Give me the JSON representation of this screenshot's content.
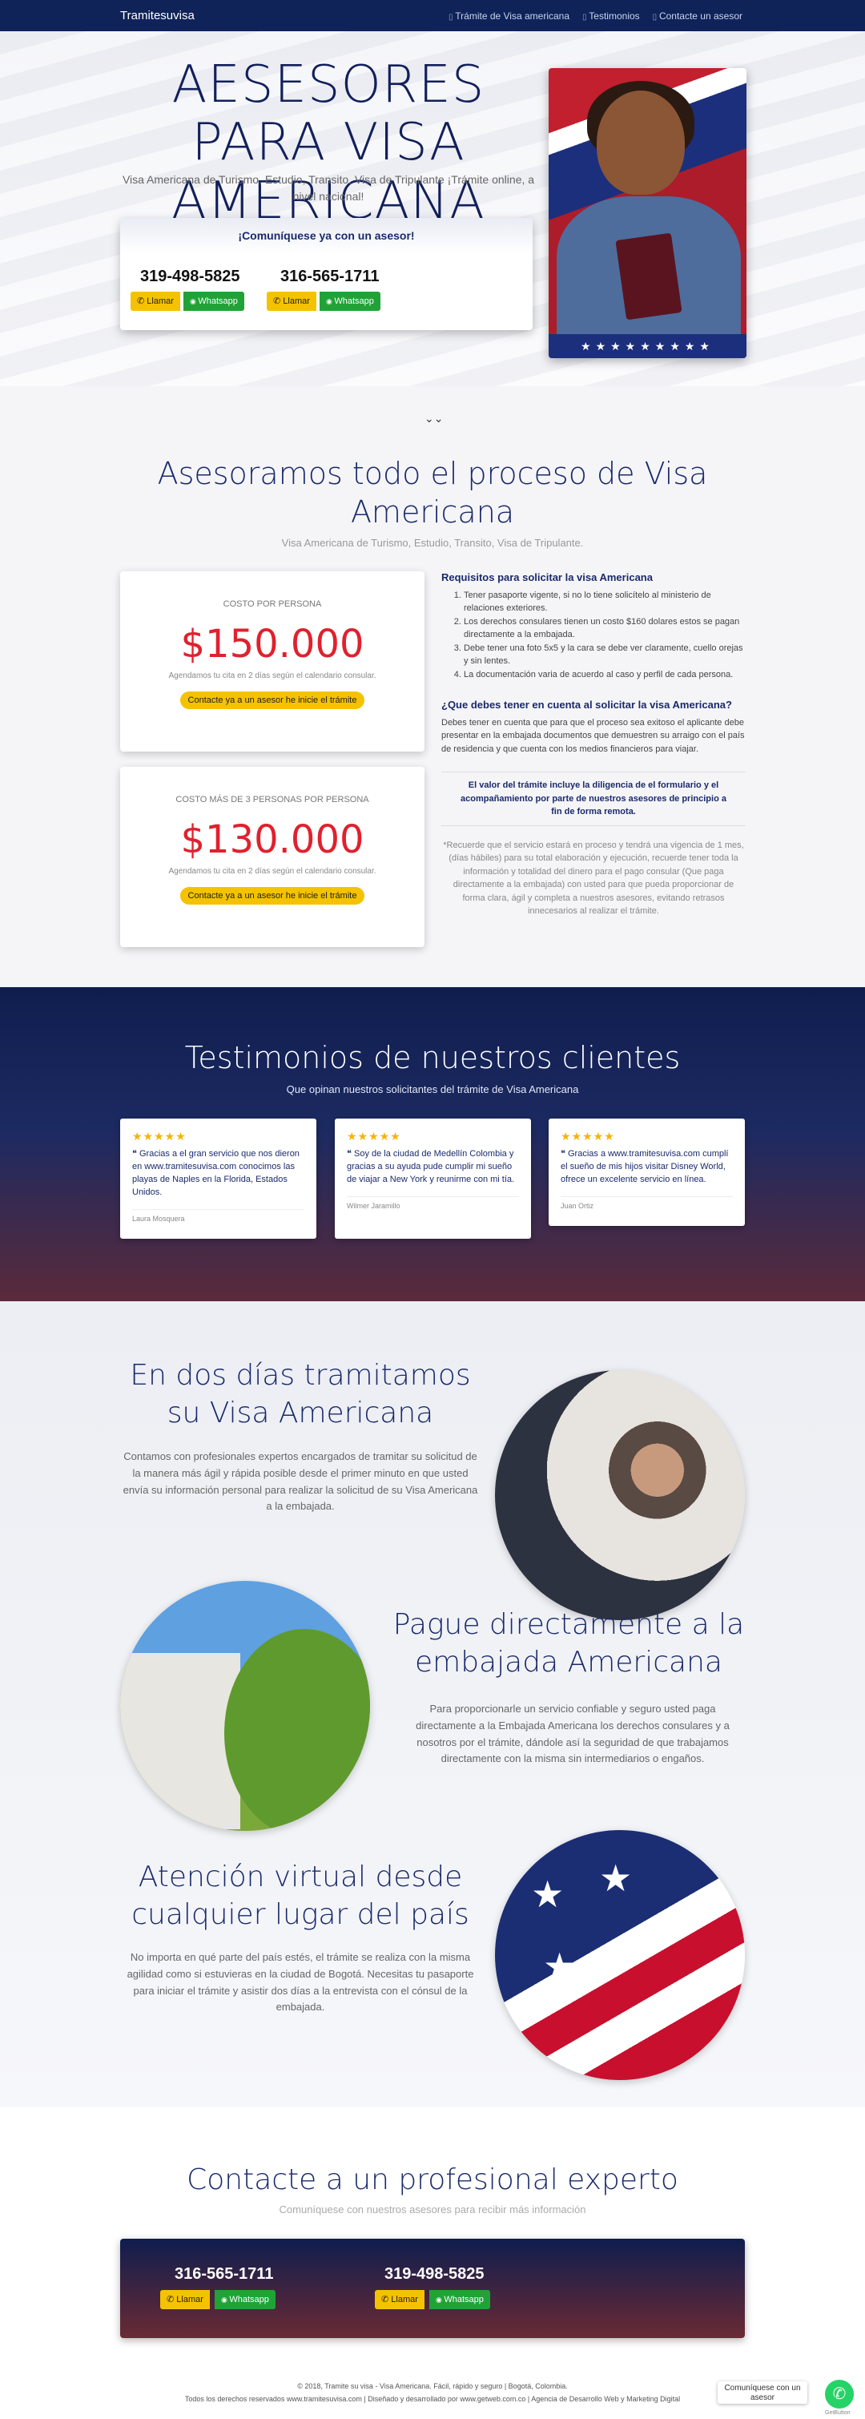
{
  "nav": {
    "brand": "Tramitesuvisa",
    "links": [
      "Trámite de Visa americana",
      "Testimonios",
      "Contacte un asesor"
    ]
  },
  "hero": {
    "title": "AESESORES PARA VISA AMERICANA",
    "subtitle": "Visa Americana de Turismo, Estudio, Transito, Visa de Tripulante ¡Trámite online, a nivel nacional!",
    "call_heading": "¡Comuníquese ya con un asesor!",
    "phones": [
      "319-498-5825",
      "316-565-1711"
    ],
    "call_label": "Llamar",
    "wa_label": "Whatsapp"
  },
  "process": {
    "title": "Asesoramos todo el proceso de Visa Americana",
    "subtitle": "Visa Americana de Turismo, Estudio, Transito, Visa de Tripulante.",
    "prices": [
      {
        "label": "COSTO POR PERSONA",
        "amount": "$150.000",
        "note": "Agendamos tu cita en 2 días según el calendario consular.",
        "cta": "Contacte ya a un asesor he inicie el trámite"
      },
      {
        "label": "COSTO MÁS DE 3 PERSONAS POR PERSONA",
        "amount": "$130.000",
        "note": "Agendamos tu cita en 2 días según el calendario consular.",
        "cta": "Contacte ya a un asesor he inicie el trámite"
      }
    ],
    "req_title": "Requisitos para solicitar la visa Americana",
    "req_items": [
      "Tener pasaporte vigente, si no lo tiene solicítelo al ministerio de relaciones exteriores.",
      "Los derechos consulares tienen un costo $160 dolares estos se pagan directamente a la embajada.",
      "Debe tener una foto 5x5 y la cara se debe ver claramente, cuello orejas y sin lentes.",
      "La documentación varia de acuerdo al caso y perfil de cada persona."
    ],
    "q_title": "¿Que debes tener en cuenta al solicitar la visa Americana?",
    "q_text": "Debes tener en cuenta que para que el proceso sea exitoso el aplicante debe presentar en la embajada documentos que demuestren su arraigo con el país de residencia y que cuenta con los medios financieros para viajar.",
    "highlight": "El valor del trámite incluye la diligencia de el formulario y el acompañamiento por parte de nuestros asesores de principio a fin de forma remota.",
    "fine": "*Recuerde que el servicio estará en proceso y tendrá una vigencia de 1 mes, (días hábiles) para su total elaboración y ejecución, recuerde tener toda la información y totalidad del dinero para el pago consular (Que paga directamente a la embajada) con usted para que pueda proporcionar de forma clara, ágil y completa a nuestros asesores, evitando retrasos innecesarios al realizar el trámite."
  },
  "testimonials": {
    "title": "Testimonios de nuestros clientes",
    "subtitle": "Que opinan nuestros solicitantes del trámite de Visa Americana",
    "stars": "★★★★★",
    "items": [
      {
        "text": "Gracias a el gran servicio que nos dieron en www.tramitesuvisa.com conocimos las playas de Naples en la Florida, Estados Unidos.",
        "author": "Laura Mosquera"
      },
      {
        "text": "Soy de la ciudad de Medellín Colombia y gracias a su ayuda pude cumplir mi sueño de viajar a New York y reunirme con mi tía.",
        "author": "Wilmer Jaramillo"
      },
      {
        "text": "Gracias a www.tramitesuvisa.com cumplí el sueño de mis hijos visitar Disney World, ofrece un excelente servicio en línea.",
        "author": "Juan Ortiz"
      }
    ]
  },
  "features": [
    {
      "title": "En dos días tramitamos su Visa Americana",
      "text": "Contamos con profesionales expertos encargados de tramitar su solicitud de la manera más ágil y rápida posible desde el primer minuto en que usted envía su información personal para realizar la solicitud de su Visa Americana a la embajada."
    },
    {
      "title": "Pague directamente a la embajada Americana",
      "text": "Para proporcionarle un servicio confiable y seguro usted paga directamente a la Embajada Americana los derechos consulares y a nosotros por el trámite, dándole así la seguridad de que trabajamos directamente con la misma sin intermediarios o engaños."
    },
    {
      "title": "Atención virtual desde cualquier lugar del país",
      "text": "No importa en qué parte del país estés, el trámite se realiza con la misma agilidad como si estuvieras en la ciudad de Bogotá. Necesitas tu pasaporte para iniciar el trámite y asistir dos días a la entrevista con el cónsul de la embajada."
    }
  ],
  "contact": {
    "title": "Contacte a un profesional experto",
    "subtitle": "Comuníquese con nuestros asesores para recibir más información",
    "phones": [
      "316-565-1711",
      "319-498-5825"
    ],
    "call_label": "Llamar",
    "wa_label": "Whatsapp"
  },
  "footer": {
    "line1": "© 2018, Tramite su visa - Visa Americana. Fácil, rápido y seguro | Bogotá, Colombia.",
    "line2": "Todos los derechos reservados www.tramitesuvisa.com | Diseñado y desarrollado por www.getweb.com.co | Agencia de Desarrollo Web y Marketing Digital"
  },
  "whatsapp_widget": {
    "bubble": "Comuníquese con un asesor",
    "small": "GetButton"
  },
  "colors": {
    "navy": "#0f2359",
    "accent_red": "#e0212e",
    "yellow": "#f5c200",
    "green": "#1fa337"
  }
}
